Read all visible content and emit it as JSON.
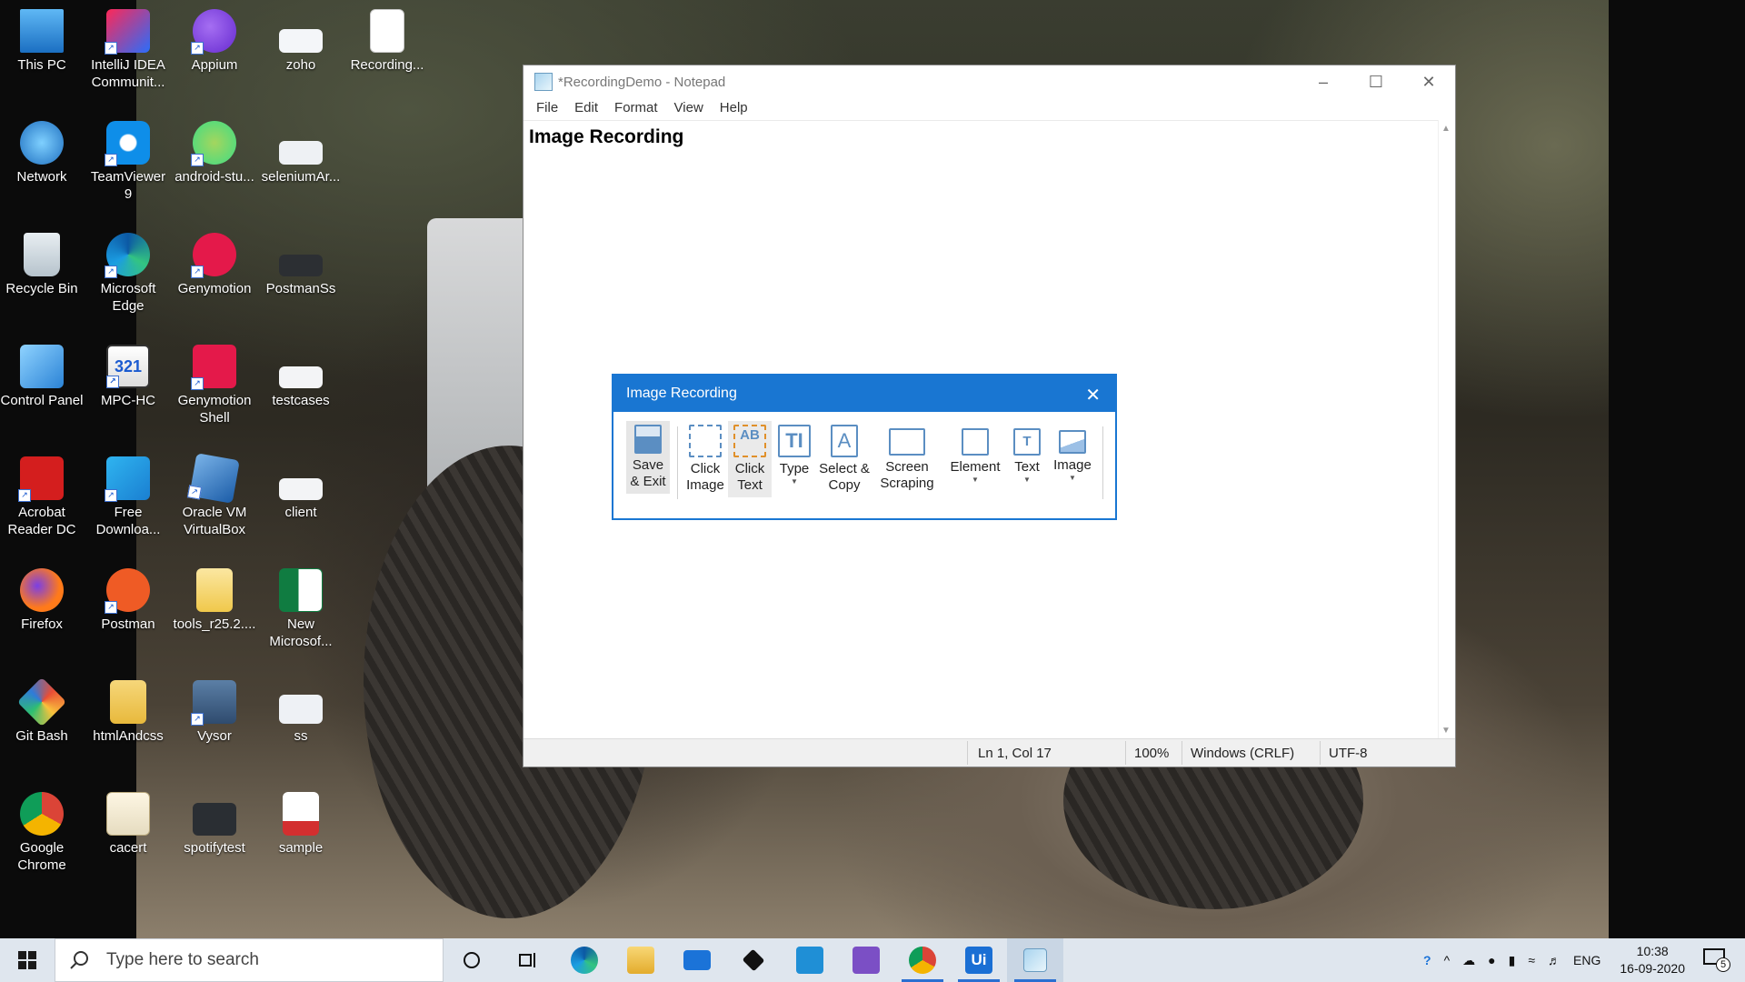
{
  "desktop_icons": [
    {
      "label": "This PC",
      "icon": "this-pc-icon"
    },
    {
      "label": "IntelliJ IDEA Communit...",
      "icon": "intellij-icon"
    },
    {
      "label": "Appium",
      "icon": "appium-icon"
    },
    {
      "label": "zoho",
      "icon": "zoho-icon"
    },
    {
      "label": "Recording...",
      "icon": "text-file-icon"
    },
    {
      "label": "Network",
      "icon": "network-icon"
    },
    {
      "label": "TeamViewer 9",
      "icon": "teamviewer-icon"
    },
    {
      "label": "android-stu...",
      "icon": "android-studio-icon"
    },
    {
      "label": "seleniumAr...",
      "icon": "image-file-icon"
    },
    {
      "label": "Recycle Bin",
      "icon": "recycle-bin-icon"
    },
    {
      "label": "Microsoft Edge",
      "icon": "edge-icon"
    },
    {
      "label": "Genymotion",
      "icon": "genymotion-icon"
    },
    {
      "label": "PostmanSs",
      "icon": "image-file-icon"
    },
    {
      "label": "Control Panel",
      "icon": "control-panel-icon"
    },
    {
      "label": "MPC-HC",
      "icon": "mpc-hc-icon"
    },
    {
      "label": "Genymotion Shell",
      "icon": "genymotion-shell-icon"
    },
    {
      "label": "testcases",
      "icon": "image-file-icon"
    },
    {
      "label": "Acrobat Reader DC",
      "icon": "acrobat-icon"
    },
    {
      "label": "Free Downloa...",
      "icon": "free-download-icon"
    },
    {
      "label": "Oracle VM VirtualBox",
      "icon": "virtualbox-icon"
    },
    {
      "label": "client",
      "icon": "image-file-icon"
    },
    {
      "label": "Firefox",
      "icon": "firefox-icon"
    },
    {
      "label": "Postman",
      "icon": "postman-icon"
    },
    {
      "label": "tools_r25.2....",
      "icon": "folder-icon"
    },
    {
      "label": "New Microsof...",
      "icon": "excel-icon"
    },
    {
      "label": "Git Bash",
      "icon": "git-bash-icon"
    },
    {
      "label": "htmlAndcss",
      "icon": "html-folder-icon"
    },
    {
      "label": "Vysor",
      "icon": "vysor-icon"
    },
    {
      "label": "ss",
      "icon": "image-file-icon"
    },
    {
      "label": "Google Chrome",
      "icon": "chrome-icon"
    },
    {
      "label": "cacert",
      "icon": "certificate-icon"
    },
    {
      "label": "spotifytest",
      "icon": "image-file-icon"
    },
    {
      "label": "sample",
      "icon": "pdf-icon"
    }
  ],
  "notepad": {
    "title": "*RecordingDemo - Notepad",
    "menu": [
      "File",
      "Edit",
      "Format",
      "View",
      "Help"
    ],
    "content": "Image Recording",
    "status": {
      "position": "Ln 1, Col 17",
      "zoom": "100%",
      "line_ending": "Windows (CRLF)",
      "encoding": "UTF-8"
    }
  },
  "recorder": {
    "title": "Image Recording",
    "buttons": {
      "save_exit": "Save & Exit",
      "click_image": "Click Image",
      "click_text": "Click Text",
      "type": "Type",
      "select_copy": "Select & Copy",
      "screen_scraping": "Screen Scraping",
      "element": "Element",
      "text": "Text",
      "image": "Image"
    }
  },
  "taskbar": {
    "search_placeholder": "Type here to search",
    "language": "ENG",
    "time": "10:38",
    "date": "16-09-2020",
    "notification_count": "5"
  },
  "colors": {
    "accent": "#1976d2",
    "taskbar": "#dfe6ee"
  }
}
